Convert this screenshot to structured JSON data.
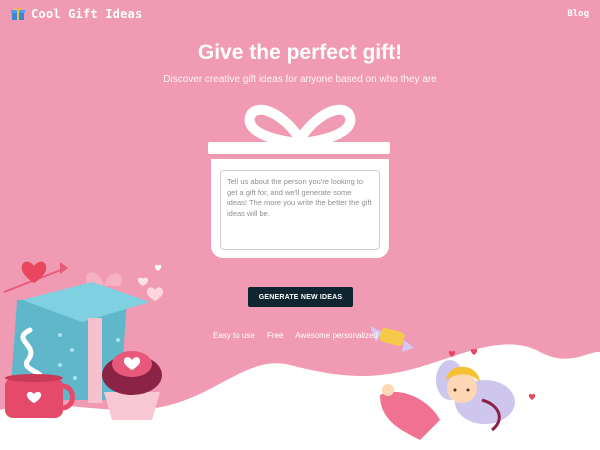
{
  "header": {
    "brand": "Cool Gift Ideas",
    "brand_icon": "gift-icon",
    "blog_link": "Blog"
  },
  "hero": {
    "title": "Give the perfect gift!",
    "subtitle": "Discover creative gift ideas for anyone based on who they are"
  },
  "form": {
    "placeholder": "Tell us about the person you're looking to get a gift for, and we'll generate some ideas! The more you write the better the gift ideas will be.",
    "value": "",
    "button_label": "GENERATE NEW IDEAS"
  },
  "features": [
    "Easy to use",
    "Free",
    "Awesome personalized"
  ],
  "colors": {
    "background": "#f09ab3",
    "button": "#0f2530",
    "white": "#ffffff"
  }
}
